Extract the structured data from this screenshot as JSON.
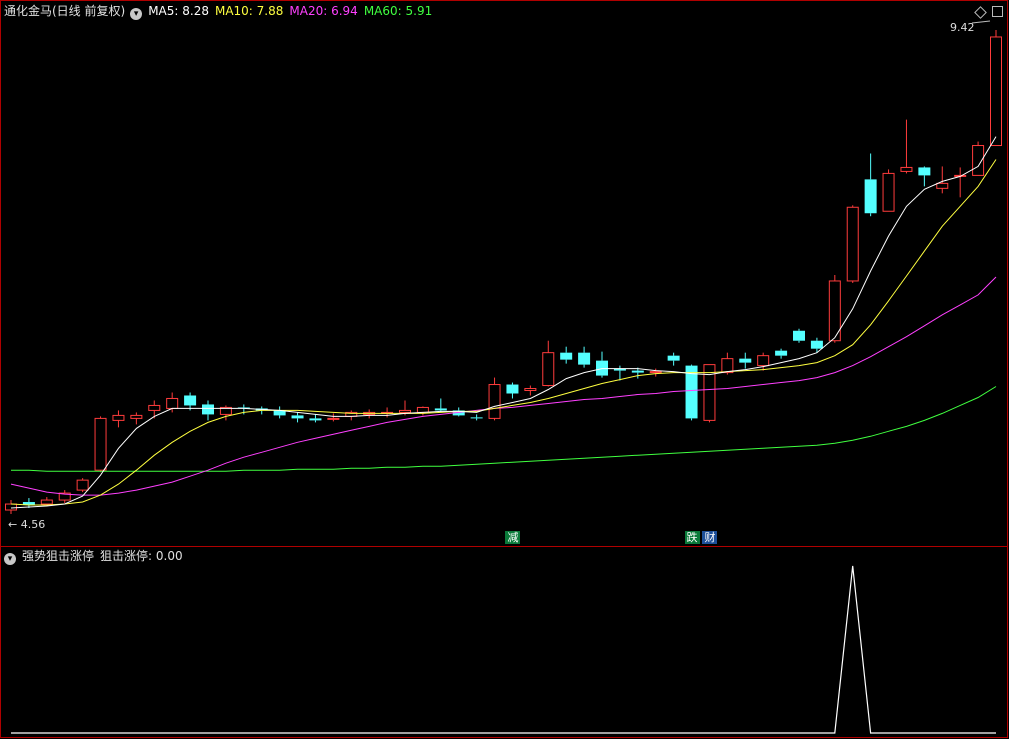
{
  "header": {
    "title": "通化金马(日线 前复权)",
    "ma_items": [
      {
        "label": "MA5: 8.28",
        "color": "#ffffff"
      },
      {
        "label": "MA10: 7.88",
        "color": "#ffff40"
      },
      {
        "label": "MA20: 6.94",
        "color": "#ff40ff"
      },
      {
        "label": "MA60: 5.91",
        "color": "#40ff40"
      }
    ]
  },
  "sub_header": {
    "title": "强势狙击涨停",
    "value_label": "狙击涨停: 0.00"
  },
  "price_labels": {
    "high": "9.42",
    "low": "4.56"
  },
  "event_tags": [
    {
      "text": "减",
      "bg": "#0a7a3a",
      "index": 28
    },
    {
      "text": "跌",
      "bg": "#0a7a3a",
      "index": 38
    },
    {
      "text": "财",
      "bg": "#1d4f99",
      "index": 39
    }
  ],
  "colors": {
    "up": "#ff3c3c",
    "down": "#54ffff",
    "border": "#b00000",
    "ma5": "#ffffff",
    "ma10": "#ffff40",
    "ma20": "#ff40ff",
    "ma60": "#40ff40"
  },
  "chart_data": [
    {
      "type": "candlestick",
      "title": "通化金马(日线 前复权)",
      "y_range": [
        4.56,
        9.42
      ],
      "candles": [
        {
          "o": 4.6,
          "h": 4.7,
          "l": 4.56,
          "c": 4.66
        },
        {
          "o": 4.68,
          "h": 4.72,
          "l": 4.62,
          "c": 4.65
        },
        {
          "o": 4.66,
          "h": 4.73,
          "l": 4.64,
          "c": 4.7
        },
        {
          "o": 4.7,
          "h": 4.8,
          "l": 4.67,
          "c": 4.77
        },
        {
          "o": 4.8,
          "h": 4.92,
          "l": 4.78,
          "c": 4.9
        },
        {
          "o": 5.0,
          "h": 5.54,
          "l": 4.98,
          "c": 5.52
        },
        {
          "o": 5.5,
          "h": 5.6,
          "l": 5.43,
          "c": 5.55
        },
        {
          "o": 5.52,
          "h": 5.58,
          "l": 5.46,
          "c": 5.55
        },
        {
          "o": 5.6,
          "h": 5.7,
          "l": 5.52,
          "c": 5.65
        },
        {
          "o": 5.62,
          "h": 5.78,
          "l": 5.58,
          "c": 5.72
        },
        {
          "o": 5.75,
          "h": 5.78,
          "l": 5.6,
          "c": 5.65
        },
        {
          "o": 5.66,
          "h": 5.7,
          "l": 5.5,
          "c": 5.56
        },
        {
          "o": 5.56,
          "h": 5.65,
          "l": 5.5,
          "c": 5.63
        },
        {
          "o": 5.63,
          "h": 5.66,
          "l": 5.56,
          "c": 5.62
        },
        {
          "o": 5.62,
          "h": 5.64,
          "l": 5.56,
          "c": 5.6
        },
        {
          "o": 5.6,
          "h": 5.64,
          "l": 5.52,
          "c": 5.55
        },
        {
          "o": 5.55,
          "h": 5.58,
          "l": 5.48,
          "c": 5.52
        },
        {
          "o": 5.52,
          "h": 5.56,
          "l": 5.48,
          "c": 5.5
        },
        {
          "o": 5.52,
          "h": 5.57,
          "l": 5.49,
          "c": 5.52
        },
        {
          "o": 5.54,
          "h": 5.6,
          "l": 5.5,
          "c": 5.58
        },
        {
          "o": 5.56,
          "h": 5.61,
          "l": 5.52,
          "c": 5.58
        },
        {
          "o": 5.58,
          "h": 5.63,
          "l": 5.53,
          "c": 5.58
        },
        {
          "o": 5.58,
          "h": 5.7,
          "l": 5.55,
          "c": 5.6
        },
        {
          "o": 5.58,
          "h": 5.64,
          "l": 5.55,
          "c": 5.63
        },
        {
          "o": 5.62,
          "h": 5.72,
          "l": 5.58,
          "c": 5.6
        },
        {
          "o": 5.6,
          "h": 5.63,
          "l": 5.54,
          "c": 5.55
        },
        {
          "o": 5.53,
          "h": 5.56,
          "l": 5.5,
          "c": 5.52
        },
        {
          "o": 5.52,
          "h": 5.93,
          "l": 5.5,
          "c": 5.86
        },
        {
          "o": 5.86,
          "h": 5.88,
          "l": 5.72,
          "c": 5.77
        },
        {
          "o": 5.8,
          "h": 5.85,
          "l": 5.75,
          "c": 5.82
        },
        {
          "o": 5.85,
          "h": 6.3,
          "l": 5.84,
          "c": 6.18
        },
        {
          "o": 6.18,
          "h": 6.24,
          "l": 6.07,
          "c": 6.11
        },
        {
          "o": 6.18,
          "h": 6.24,
          "l": 6.03,
          "c": 6.06
        },
        {
          "o": 6.1,
          "h": 6.19,
          "l": 5.93,
          "c": 5.95
        },
        {
          "o": 6.02,
          "h": 6.05,
          "l": 5.9,
          "c": 6.0
        },
        {
          "o": 6.0,
          "h": 6.03,
          "l": 5.92,
          "c": 5.98
        },
        {
          "o": 5.98,
          "h": 6.02,
          "l": 5.94,
          "c": 5.99
        },
        {
          "o": 6.15,
          "h": 6.18,
          "l": 6.05,
          "c": 6.1
        },
        {
          "o": 6.05,
          "h": 6.06,
          "l": 5.5,
          "c": 5.52
        },
        {
          "o": 5.5,
          "h": 6.06,
          "l": 5.48,
          "c": 6.06
        },
        {
          "o": 5.98,
          "h": 6.18,
          "l": 5.96,
          "c": 6.12
        },
        {
          "o": 6.12,
          "h": 6.18,
          "l": 6.02,
          "c": 6.08
        },
        {
          "o": 6.05,
          "h": 6.18,
          "l": 6.0,
          "c": 6.15
        },
        {
          "o": 6.2,
          "h": 6.22,
          "l": 6.12,
          "c": 6.15
        },
        {
          "o": 6.4,
          "h": 6.42,
          "l": 6.28,
          "c": 6.3
        },
        {
          "o": 6.3,
          "h": 6.33,
          "l": 6.18,
          "c": 6.22
        },
        {
          "o": 6.3,
          "h": 6.96,
          "l": 6.28,
          "c": 6.9
        },
        {
          "o": 6.9,
          "h": 7.66,
          "l": 6.88,
          "c": 7.64
        },
        {
          "o": 7.92,
          "h": 8.18,
          "l": 7.55,
          "c": 7.58
        },
        {
          "o": 7.6,
          "h": 8.02,
          "l": 7.6,
          "c": 7.98
        },
        {
          "o": 8.0,
          "h": 8.52,
          "l": 7.98,
          "c": 8.04
        },
        {
          "o": 8.04,
          "h": 8.05,
          "l": 7.85,
          "c": 7.96
        },
        {
          "o": 7.83,
          "h": 8.05,
          "l": 7.78,
          "c": 7.88
        },
        {
          "o": 7.96,
          "h": 8.04,
          "l": 7.74,
          "c": 7.96
        },
        {
          "o": 7.96,
          "h": 8.3,
          "l": 7.96,
          "c": 8.26
        },
        {
          "o": 8.26,
          "h": 9.42,
          "l": 8.27,
          "c": 9.35
        }
      ],
      "ma5": [
        4.62,
        4.63,
        4.64,
        4.66,
        4.74,
        4.95,
        5.22,
        5.42,
        5.54,
        5.62,
        5.62,
        5.62,
        5.62,
        5.62,
        5.61,
        5.6,
        5.58,
        5.56,
        5.54,
        5.54,
        5.55,
        5.55,
        5.57,
        5.58,
        5.59,
        5.59,
        5.58,
        5.64,
        5.68,
        5.72,
        5.81,
        5.92,
        5.98,
        6.02,
        6.02,
        6.02,
        6.0,
        5.99,
        5.97,
        5.96,
        5.99,
        6.01,
        6.04,
        6.08,
        6.12,
        6.18,
        6.33,
        6.62,
        7.0,
        7.35,
        7.65,
        7.82,
        7.9,
        7.95,
        8.05,
        8.35
      ],
      "ma10": [
        4.66,
        4.65,
        4.65,
        4.66,
        4.68,
        4.75,
        4.86,
        5.0,
        5.15,
        5.28,
        5.39,
        5.48,
        5.54,
        5.58,
        5.6,
        5.6,
        5.6,
        5.59,
        5.58,
        5.57,
        5.57,
        5.57,
        5.57,
        5.57,
        5.58,
        5.59,
        5.59,
        5.62,
        5.65,
        5.68,
        5.72,
        5.77,
        5.82,
        5.87,
        5.91,
        5.95,
        5.97,
        5.98,
        5.98,
        5.98,
        5.99,
        6.0,
        6.01,
        6.03,
        6.05,
        6.08,
        6.15,
        6.26,
        6.46,
        6.7,
        6.95,
        7.2,
        7.45,
        7.65,
        7.85,
        8.12
      ],
      "ma20": [
        4.86,
        4.82,
        4.78,
        4.76,
        4.75,
        4.75,
        4.77,
        4.8,
        4.84,
        4.88,
        4.94,
        5.0,
        5.07,
        5.13,
        5.18,
        5.23,
        5.28,
        5.32,
        5.36,
        5.4,
        5.44,
        5.48,
        5.51,
        5.54,
        5.56,
        5.58,
        5.6,
        5.62,
        5.63,
        5.65,
        5.67,
        5.69,
        5.71,
        5.72,
        5.74,
        5.76,
        5.77,
        5.79,
        5.8,
        5.81,
        5.82,
        5.84,
        5.86,
        5.88,
        5.9,
        5.93,
        5.98,
        6.05,
        6.14,
        6.24,
        6.34,
        6.45,
        6.56,
        6.66,
        6.76,
        6.94
      ],
      "ma60": [
        5.0,
        5.0,
        4.99,
        4.99,
        4.99,
        4.99,
        4.99,
        4.99,
        4.99,
        4.99,
        4.99,
        4.99,
        4.99,
        5.0,
        5.0,
        5.0,
        5.01,
        5.01,
        5.01,
        5.02,
        5.02,
        5.03,
        5.03,
        5.04,
        5.04,
        5.05,
        5.06,
        5.07,
        5.08,
        5.09,
        5.1,
        5.11,
        5.12,
        5.13,
        5.14,
        5.15,
        5.16,
        5.17,
        5.18,
        5.19,
        5.2,
        5.21,
        5.22,
        5.23,
        5.24,
        5.25,
        5.27,
        5.3,
        5.34,
        5.39,
        5.44,
        5.5,
        5.57,
        5.65,
        5.73,
        5.84
      ]
    },
    {
      "type": "line",
      "title": "强势狙击涨停",
      "series_name": "狙击涨停",
      "y_range": [
        0,
        1
      ],
      "values": [
        0,
        0,
        0,
        0,
        0,
        0,
        0,
        0,
        0,
        0,
        0,
        0,
        0,
        0,
        0,
        0,
        0,
        0,
        0,
        0,
        0,
        0,
        0,
        0,
        0,
        0,
        0,
        0,
        0,
        0,
        0,
        0,
        0,
        0,
        0,
        0,
        0,
        0,
        0,
        0,
        0,
        0,
        0,
        0,
        0,
        0,
        0,
        1,
        0,
        0,
        0,
        0,
        0,
        0,
        0,
        0
      ]
    }
  ]
}
